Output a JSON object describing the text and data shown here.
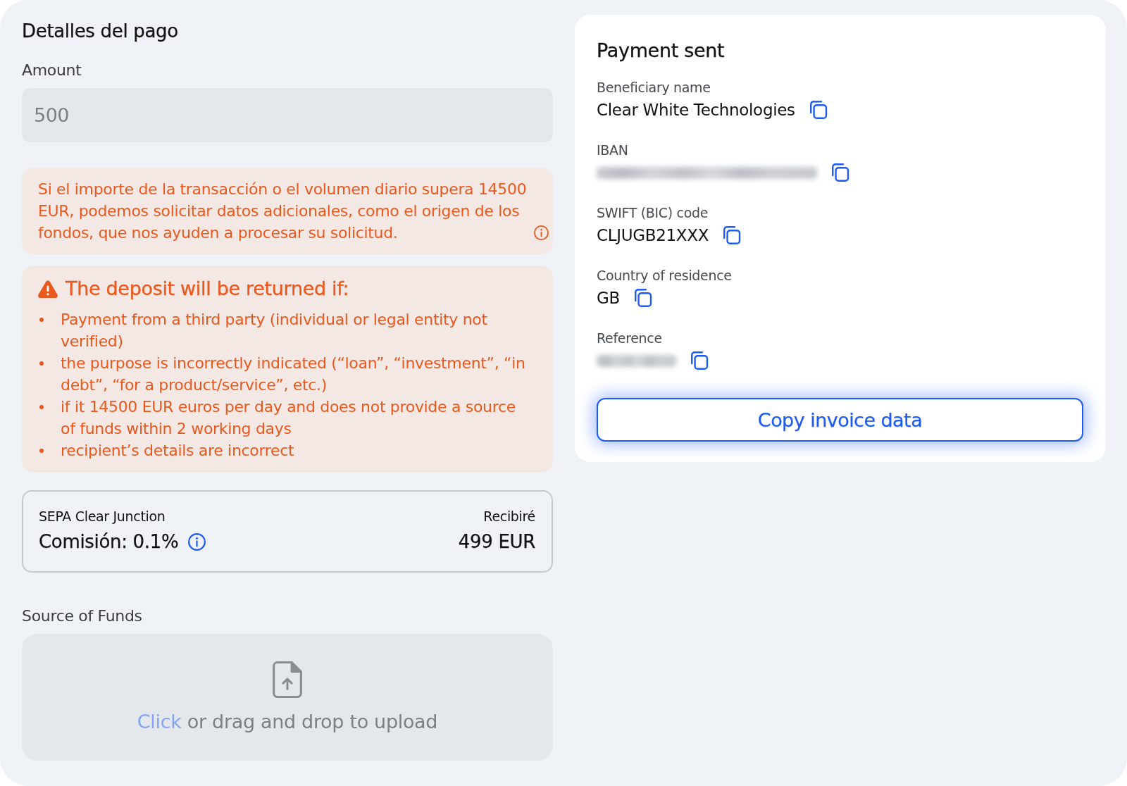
{
  "payment_details": {
    "title": "Detalles del pago",
    "amount": {
      "label": "Amount",
      "value": "500",
      "disabled": true
    },
    "limit_notice": "Si el importe de la transacción o el volumen diario supera 14500 EUR, podemos solicitar datos adicionales, como el origen de los fondos, que nos ayuden a procesar su solicitud.",
    "return_warning": {
      "title": "The deposit will be returned if:",
      "items": [
        "Payment from a third party (individual or legal entity not verified)",
        "the purpose is incorrectly indicated (“loan”, “investment”, “in debt”, “for a product/service”, etc.)",
        "if it 14500 EUR euros per day and does not provide a source of funds within 2 working days",
        "recipient’s details are incorrect"
      ]
    },
    "fee": {
      "provider": "SEPA Clear Junction",
      "commission": "Comisión: 0.1%",
      "receive_label": "Recibiré",
      "receive_amount": "499 EUR"
    },
    "source_of_funds": {
      "label": "Source of Funds",
      "upload_link": "Click",
      "upload_text": "or drag and drop to upload"
    }
  },
  "payment_sent": {
    "title": "Payment sent",
    "details": [
      {
        "label": "Beneficiary name",
        "kind": "text",
        "value": "Clear White Technologies"
      },
      {
        "label": "IBAN",
        "kind": "redacted"
      },
      {
        "label": "SWIFT (BIC) code",
        "kind": "text",
        "value": "CLJUGB21XXX"
      },
      {
        "label": "Country of residence",
        "kind": "text",
        "value": "GB"
      },
      {
        "label": "Reference",
        "kind": "redacted"
      }
    ],
    "button": "Copy invoice data"
  }
}
